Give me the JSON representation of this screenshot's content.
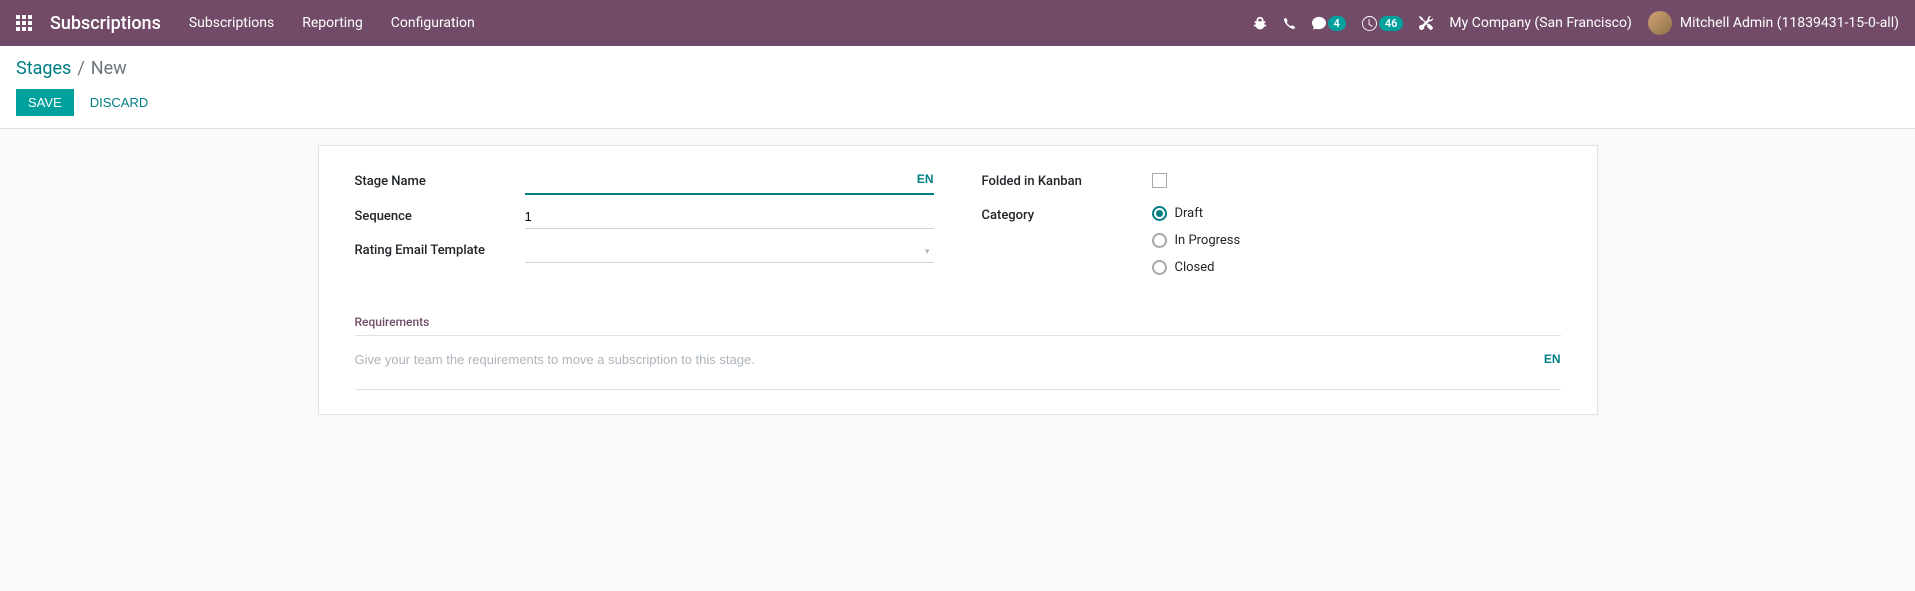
{
  "navbar": {
    "brand": "Subscriptions",
    "menu": [
      "Subscriptions",
      "Reporting",
      "Configuration"
    ],
    "msg_badge": "4",
    "activity_badge": "46",
    "company": "My Company (San Francisco)",
    "user": "Mitchell Admin (11839431-15-0-all)"
  },
  "breadcrumb": {
    "parent": "Stages",
    "sep": "/",
    "current": "New"
  },
  "buttons": {
    "save": "Save",
    "discard": "Discard"
  },
  "form": {
    "stage_name_label": "Stage Name",
    "stage_name_value": "",
    "lang": "EN",
    "sequence_label": "Sequence",
    "sequence_value": "1",
    "rating_label": "Rating Email Template",
    "rating_value": "",
    "folded_label": "Folded in Kanban",
    "category_label": "Category",
    "category_options": {
      "draft": "Draft",
      "progress": "In Progress",
      "closed": "Closed"
    },
    "requirements_label": "Requirements",
    "requirements_placeholder": "Give your team the requirements to move a subscription to this stage."
  }
}
